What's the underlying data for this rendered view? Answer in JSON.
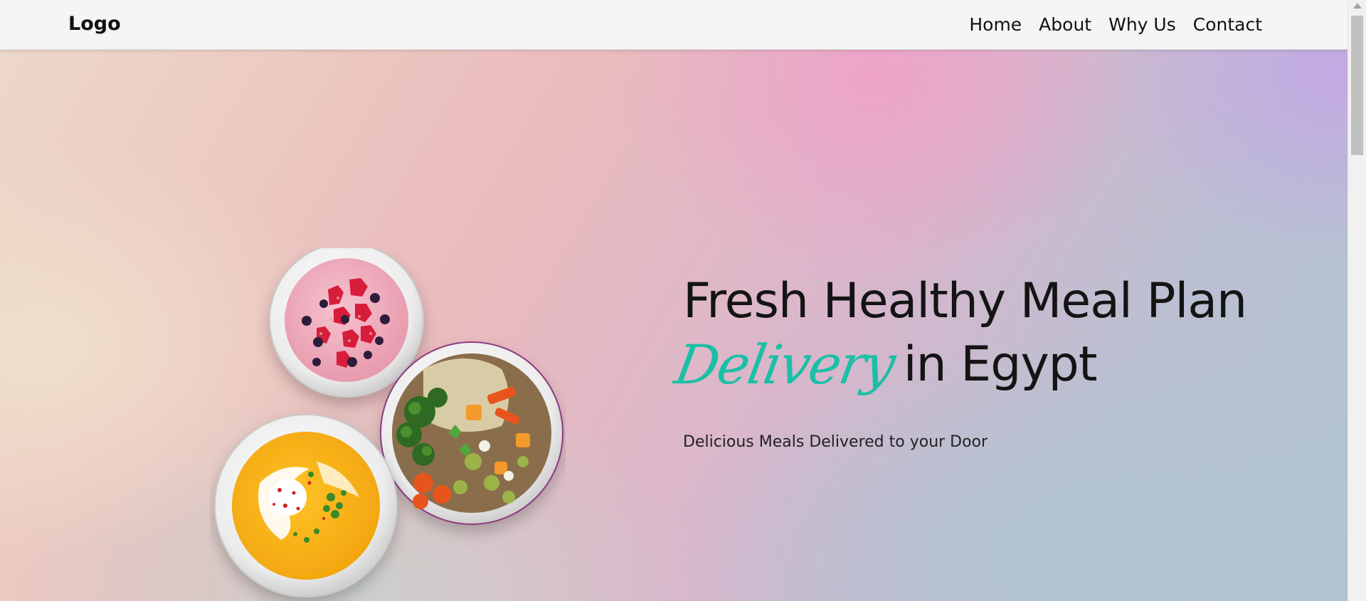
{
  "nav": {
    "logo": "Logo",
    "links": [
      {
        "label": "Home"
      },
      {
        "label": "About"
      },
      {
        "label": "Why Us"
      },
      {
        "label": "Contact"
      }
    ]
  },
  "hero": {
    "headline_line1": "Fresh Healthy Meal Plan",
    "headline_script": "Delivery",
    "headline_line2_rest": "in Egypt",
    "subheadline": "Delicious Meals Delivered to your Door",
    "accent_color": "#1bbfa6"
  },
  "images": [
    {
      "name": "berry-smoothie-bowl"
    },
    {
      "name": "vegetable-grain-bowl"
    },
    {
      "name": "pumpkin-soup-bowl"
    }
  ]
}
